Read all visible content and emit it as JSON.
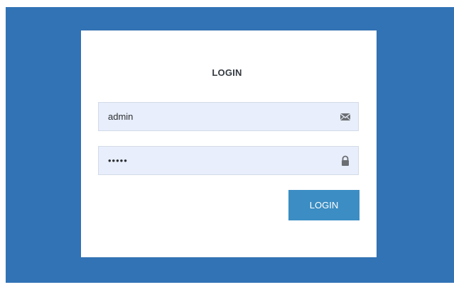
{
  "login_form": {
    "title": "LOGIN",
    "username": {
      "value": "admin",
      "icon": "envelope-icon"
    },
    "password": {
      "value": "•••••",
      "icon": "lock-icon"
    },
    "submit_label": "LOGIN"
  },
  "colors": {
    "background": "#3273b6",
    "card": "#ffffff",
    "input_fill": "#e8eefb",
    "button": "#3b8dc3"
  }
}
